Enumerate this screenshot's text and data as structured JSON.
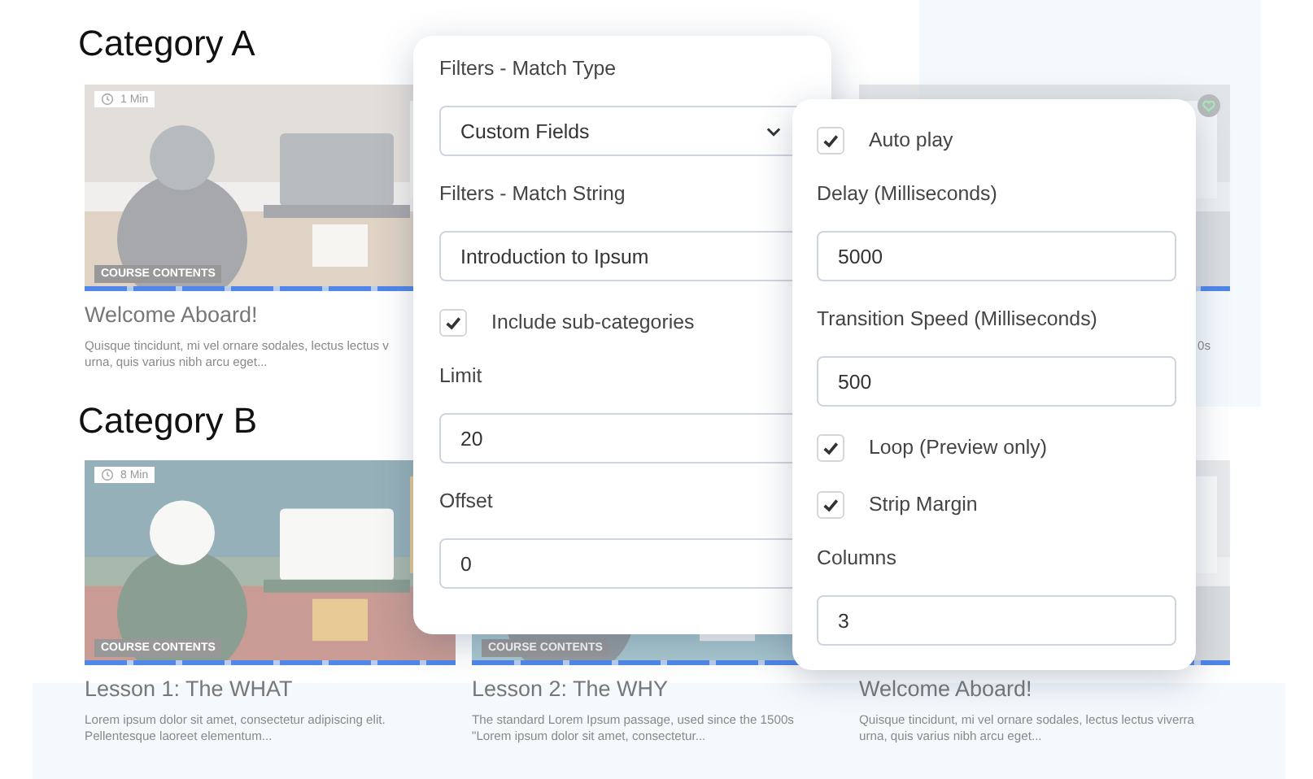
{
  "sections": [
    {
      "heading": "Category A",
      "cards": [
        {
          "kind": "full",
          "duration": "1 Min",
          "tag": "COURSE CONTENTS",
          "title": "Welcome Aboard!",
          "description": [
            "Quisque tincidunt, mi vel ornare sodales, lectus lectus v",
            "urna, quis varius nibh arcu eget..."
          ]
        },
        {
          "kind": "edge",
          "favorite": true,
          "description": [
            "0s"
          ]
        }
      ]
    },
    {
      "heading": "Category B",
      "cards": [
        {
          "kind": "full",
          "duration": "8 Min",
          "tag": "COURSE CONTENTS",
          "title": "Lesson 1: The WHAT",
          "description": [
            "Lorem ipsum dolor sit amet, consectetur adipiscing elit.",
            "Pellentesque laoreet elementum..."
          ]
        },
        {
          "kind": "full",
          "tag": "COURSE CONTENTS",
          "title": "Lesson 2: The WHY",
          "description": [
            "The standard Lorem Ipsum passage, used since the 1500s",
            "\"Lorem ipsum dolor sit amet, consectetur..."
          ]
        },
        {
          "kind": "full",
          "title": "Welcome Aboard!",
          "description": [
            "Quisque tincidunt, mi vel ornare sodales, lectus lectus viverra",
            "urna, quis varius nibh arcu eget..."
          ]
        }
      ]
    }
  ],
  "panels": [
    {
      "fields": [
        {
          "kind": "select",
          "label": "Filters - Match Type",
          "value": "Custom Fields"
        },
        {
          "kind": "input",
          "label": "Filters - Match String",
          "value": "Introduction to Ipsum"
        },
        {
          "kind": "checkbox",
          "label": "Include sub-categories",
          "checked": true
        },
        {
          "kind": "input",
          "label": "Limit",
          "value": "20"
        },
        {
          "kind": "input",
          "label": "Offset",
          "value": "0"
        }
      ]
    },
    {
      "fields": [
        {
          "kind": "checkbox",
          "label": "Auto play",
          "checked": true
        },
        {
          "kind": "input",
          "label": "Delay (Milliseconds)",
          "value": "5000"
        },
        {
          "kind": "input",
          "label": "Transition Speed (Milliseconds)",
          "value": "500"
        },
        {
          "kind": "checkbox",
          "label": "Loop (Preview only)",
          "checked": true
        },
        {
          "kind": "checkbox",
          "label": "Strip Margin",
          "checked": true
        },
        {
          "kind": "input",
          "label": "Columns",
          "value": "3"
        }
      ]
    }
  ]
}
